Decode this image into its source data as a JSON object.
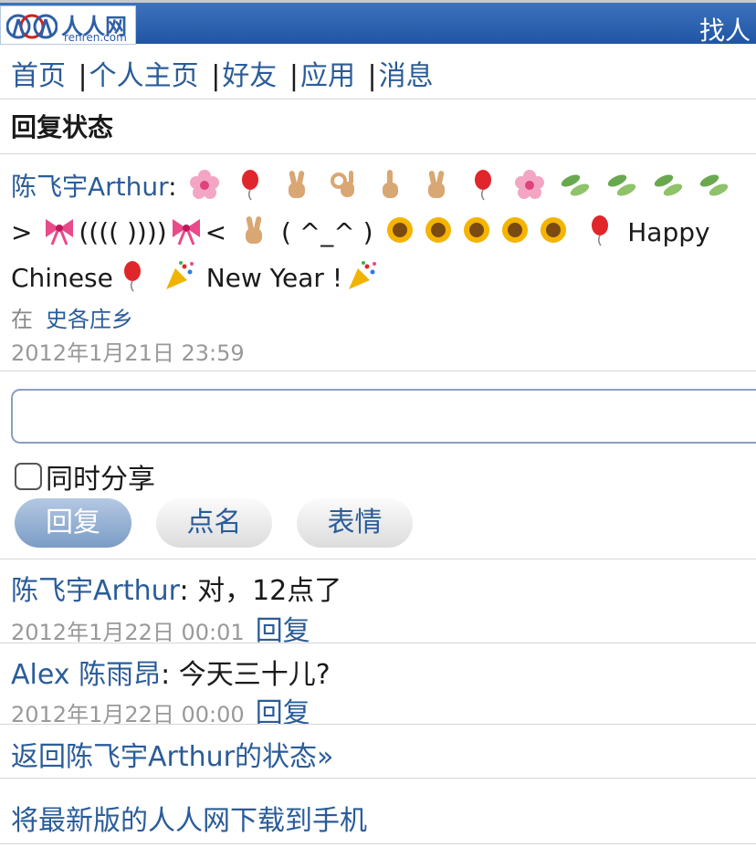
{
  "header": {
    "logo_cn": "人人网",
    "logo_en": "renren.com",
    "find_link": "找人"
  },
  "nav": {
    "items": [
      "首页",
      "个人主页",
      "好友",
      "应用",
      "消息"
    ],
    "separator": "|"
  },
  "page_title": "回复状态",
  "status": {
    "author": "陈飞宇Arthur",
    "colon": ":",
    "text_gt": ">",
    "text_paren": "(((( ))))",
    "text_lt": "<",
    "text_face": "( ^_^ )",
    "text_happy": "Happy Chinese",
    "text_newyear": "New Year !",
    "location_prefix": "在",
    "location": "史各庄乡",
    "time": "2012年1月21日 23:59"
  },
  "reply_form": {
    "input_value": "",
    "share_label": "同时分享",
    "share_checked": false,
    "reply_button": "回复",
    "mention_button": "点名",
    "emoji_button": "表情"
  },
  "comments": [
    {
      "author": "陈飞宇Arthur",
      "text": ": 对，12点了",
      "time": "2012年1月22日 00:01",
      "reply": "回复"
    },
    {
      "author": "Alex 陈雨昂",
      "text": ": 今天三十儿?",
      "time": "2012年1月22日 00:00",
      "reply": "回复"
    }
  ],
  "footer": {
    "back_link": "返回陈飞宇Arthur的状态»",
    "download_link": "将最新版的人人网下载到手机"
  },
  "colors": {
    "header_blue": "#1f55a3",
    "link_blue": "#2a5c99",
    "meta_grey": "#999999"
  },
  "emoji_icons": [
    "flower",
    "balloon",
    "victory-hand",
    "ok-hand",
    "pointing-up",
    "victory-hand",
    "balloon",
    "flower",
    "leaves",
    "leaves",
    "leaves",
    "leaves",
    "ribbon",
    "ribbon",
    "victory-hand",
    "sunflower",
    "sunflower",
    "sunflower",
    "sunflower",
    "sunflower",
    "balloon",
    "balloon",
    "party-popper",
    "party-popper"
  ]
}
